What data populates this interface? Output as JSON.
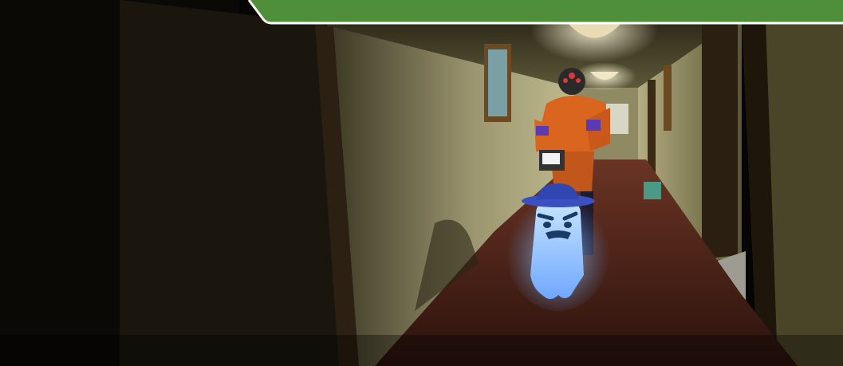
{
  "scene": {
    "setting": "hotel-hallway",
    "characters": [
      "ghost-player",
      "hunter-enemy"
    ],
    "hud": {
      "top_banner_color": "#4f8f3a",
      "top_banner_border_color": "#ffffff"
    },
    "colors": {
      "wall_lit": "#a09a72",
      "carpet": "#5a2a1f",
      "ghost_body": "#8ec4ff",
      "ghost_hat": "#3a4fc0",
      "hunter_suit": "#d9651f",
      "hunter_accent": "#5b3bb3"
    },
    "props": [
      "wall-painting",
      "ceiling-light",
      "trash-bin",
      "window"
    ]
  }
}
